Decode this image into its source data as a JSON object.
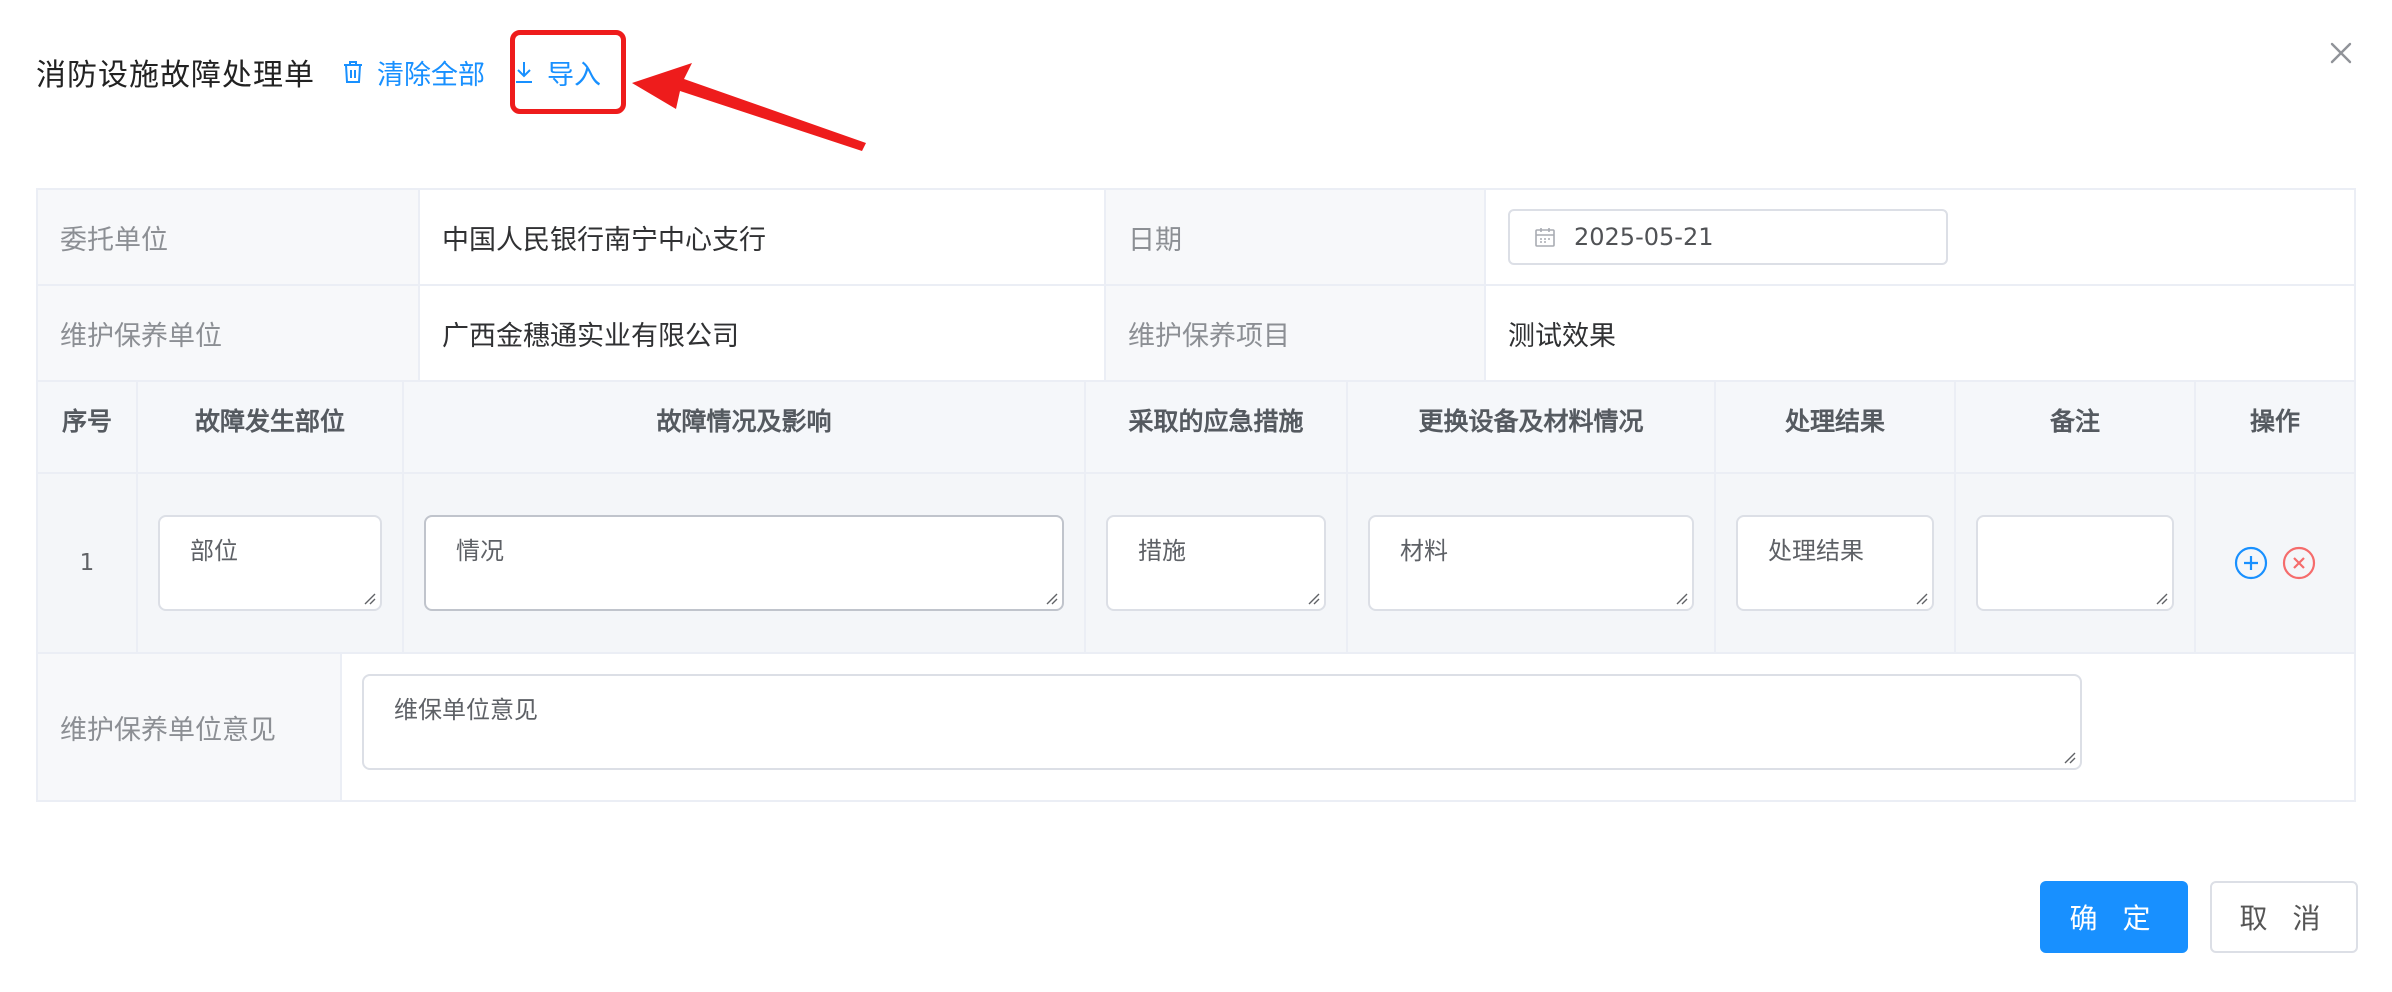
{
  "dialog": {
    "title": "消防设施故障处理单",
    "clear_all_label": "清除全部",
    "import_label": "导入",
    "close_icon": "close-icon"
  },
  "info": {
    "client_label": "委托单位",
    "client_value": "中国人民银行南宁中心支行",
    "date_label": "日期",
    "date_value": "2025-05-21",
    "maint_unit_label": "维护保养单位",
    "maint_unit_value": "广西金穗通实业有限公司",
    "maint_project_label": "维护保养项目",
    "maint_project_value": "测试效果"
  },
  "table": {
    "columns": [
      "序号",
      "故障发生部位",
      "故障情况及影响",
      "采取的应急措施",
      "更换设备及材料情况",
      "处理结果",
      "备注",
      "操作"
    ],
    "rows": [
      {
        "index": "1",
        "location": "部位",
        "situation": "情况",
        "measures": "措施",
        "materials": "材料",
        "result": "处理结果",
        "remark": ""
      }
    ]
  },
  "opinion": {
    "label": "维护保养单位意见",
    "value": "维保单位意见"
  },
  "footer": {
    "confirm_label": "确 定",
    "cancel_label": "取 消"
  },
  "colors": {
    "primary": "#1890ff",
    "annotation_red": "#ee1c1c",
    "danger": "#f56c6c"
  }
}
